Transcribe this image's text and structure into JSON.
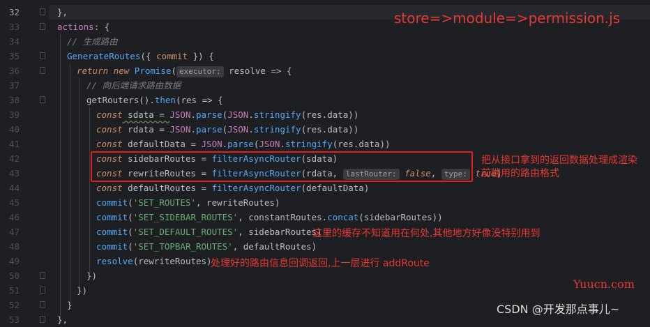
{
  "line_numbers": [
    "32",
    "33",
    "34",
    "35",
    "36",
    "37",
    "38",
    "39",
    "40",
    "41",
    "42",
    "43",
    "44",
    "45",
    "46",
    "47",
    "48",
    "49",
    "50",
    "51",
    "52",
    "53"
  ],
  "code": {
    "l32": "},",
    "l33_key": "actions",
    "l33_rest": ": {",
    "l34": "// 生成路由",
    "l35_fn": "GenerateRoutes",
    "l35_p1": "({ ",
    "l35_arg": "commit",
    "l35_p2": " }) {",
    "l36_return": "return",
    "l36_new": "new",
    "l36_promise": "Promise",
    "l36_p1": "(",
    "l36_hint": "executor:",
    "l36_rest": " resolve => {",
    "l37": "// 向后端请求路由数据",
    "l38_fn": "getRouters",
    "l38_p1": "().",
    "l38_then": "then",
    "l38_rest": "(res => {",
    "const": "const",
    "l39_var": " sdata = ",
    "l40_var": " rdata = ",
    "l41_var": " defaultData = ",
    "json": "JSON",
    "dot": ".",
    "parse": "parse",
    "stringify": "stringify",
    "res_data": "(res.data))",
    "open": "(",
    "l42_var": " sidebarRoutes = ",
    "l42_fn": "filterAsyncRouter",
    "l42_rest": "(sdata)",
    "l43_var": " rewriteRoutes = ",
    "l43_fn": "filterAsyncRouter",
    "l43_p1": "(rdata, ",
    "l43_hint1": "lastRouter:",
    "l43_false": " false",
    "l43_comma": ", ",
    "l43_hint2": "type:",
    "l43_true": " true",
    "l43_close": ")",
    "l44_var": " defaultRoutes = ",
    "l44_fn": "filterAsyncRouter",
    "l44_rest": "(defaultData)",
    "commit": "commit",
    "l45_str": "'SET_ROUTES'",
    "l45_rest": ", rewriteRoutes)",
    "l46_str": "'SET_SIDEBAR_ROUTES'",
    "l46_mid": ", constantRoutes.",
    "l46_concat": "concat",
    "l46_rest": "(sidebarRoutes))",
    "l47_str": "'SET_DEFAULT_ROUTES'",
    "l47_rest": ", sidebarRoutes)",
    "l48_str": "'SET_TOPBAR_ROUTES'",
    "l48_rest": ", defaultRoutes)",
    "l49_fn": "resolve",
    "l49_rest": "(rewriteRoutes)",
    "l50": "})",
    "l51": "})",
    "l52": "}",
    "l53": "},"
  },
  "annotations": {
    "title": "store=>module=>permission.js",
    "box_note_line1": "把从接口拿到的返回数据处理成渲染",
    "box_note_line2": "前端用的路由格式",
    "cache_note": "这里的缓存不知道用在何处,其他地方好像没特别用到",
    "resolve_note": "处理好的路由信息回调返回,上一层进行 addRoute"
  },
  "watermarks": {
    "yuucn": "Yuucn.com",
    "csdn": "CSDN @开发那点事儿~"
  },
  "colors": {
    "background": "#1e1f22",
    "annotation_red": "#e53935",
    "keyword": "#cf8e6d",
    "function": "#56a8f5",
    "string": "#6aab73",
    "comment": "#7a7e85"
  }
}
